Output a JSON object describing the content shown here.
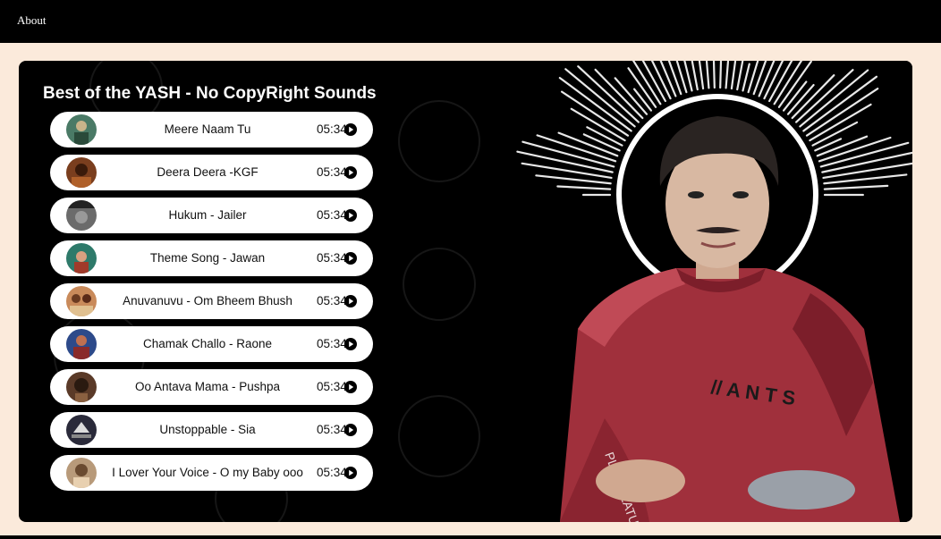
{
  "nav": {
    "about_label": "About"
  },
  "playlist": {
    "title": "Best of the YASH - No CopyRight Sounds",
    "songs": [
      {
        "name": "Meere Naam Tu",
        "duration": "05:34",
        "cover_color": "#4a7a66"
      },
      {
        "name": "Deera Deera -KGF",
        "duration": "05:34",
        "cover_color": "#7a3e1e"
      },
      {
        "name": "Hukum - Jailer",
        "duration": "05:34",
        "cover_color": "#6b6b6b"
      },
      {
        "name": "Theme Song - Jawan",
        "duration": "05:34",
        "cover_color": "#2e7a6a"
      },
      {
        "name": "Anuvanuvu - Om Bheem Bhush",
        "duration": "05:34",
        "cover_color": "#c98a5a"
      },
      {
        "name": "Chamak Challo - Raone",
        "duration": "05:34",
        "cover_color": "#2d4a8a"
      },
      {
        "name": "Oo Antava Mama - Pushpa",
        "duration": "05:34",
        "cover_color": "#5a3a28"
      },
      {
        "name": "Unstoppable - Sia",
        "duration": "05:34",
        "cover_color": "#2a2a3a"
      },
      {
        "name": "I Lover Your Voice - O my Baby ooo",
        "duration": "05:34",
        "cover_color": "#b89a7a"
      }
    ]
  },
  "icons": {
    "play": "play-circle-icon",
    "cover": "album-cover-icon"
  },
  "colors": {
    "page_background": "#fbeadb",
    "panel_background": "#000000",
    "song_pill": "#ffffff",
    "shirt": "#a0303c"
  }
}
